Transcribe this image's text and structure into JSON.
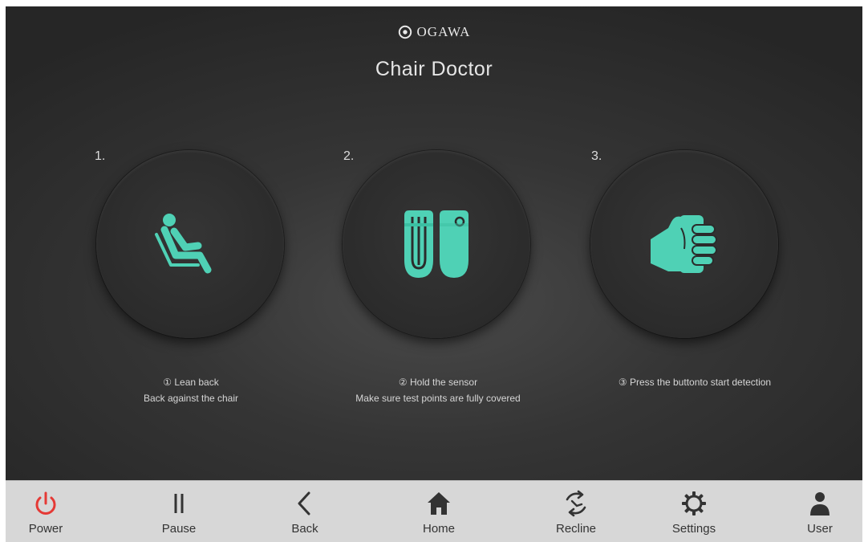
{
  "header": {
    "brand": "OGAWA",
    "title": "Chair Doctor"
  },
  "steps": [
    {
      "number": "1.",
      "icon": "recline-seat-icon",
      "line1": "① Lean back",
      "line2": "Back against the chair"
    },
    {
      "number": "2.",
      "icon": "sensor-icon",
      "line1": "② Hold the sensor",
      "line2": "Make sure test points are fully covered"
    },
    {
      "number": "3.",
      "icon": "hand-grip-icon",
      "line1": "③ Press the buttonto start detection",
      "line2": ""
    }
  ],
  "nav": [
    {
      "label": "Power",
      "icon": "power-icon"
    },
    {
      "label": "Pause",
      "icon": "pause-icon"
    },
    {
      "label": "Back",
      "icon": "chevron-left-icon"
    },
    {
      "label": "Home",
      "icon": "home-icon"
    },
    {
      "label": "Recline",
      "icon": "recline-icon"
    },
    {
      "label": "Settings",
      "icon": "gear-icon"
    },
    {
      "label": "User",
      "icon": "user-icon"
    }
  ],
  "colors": {
    "accent": "#4fd1b5",
    "power": "#e53935",
    "bar": "#d7d7d7"
  }
}
